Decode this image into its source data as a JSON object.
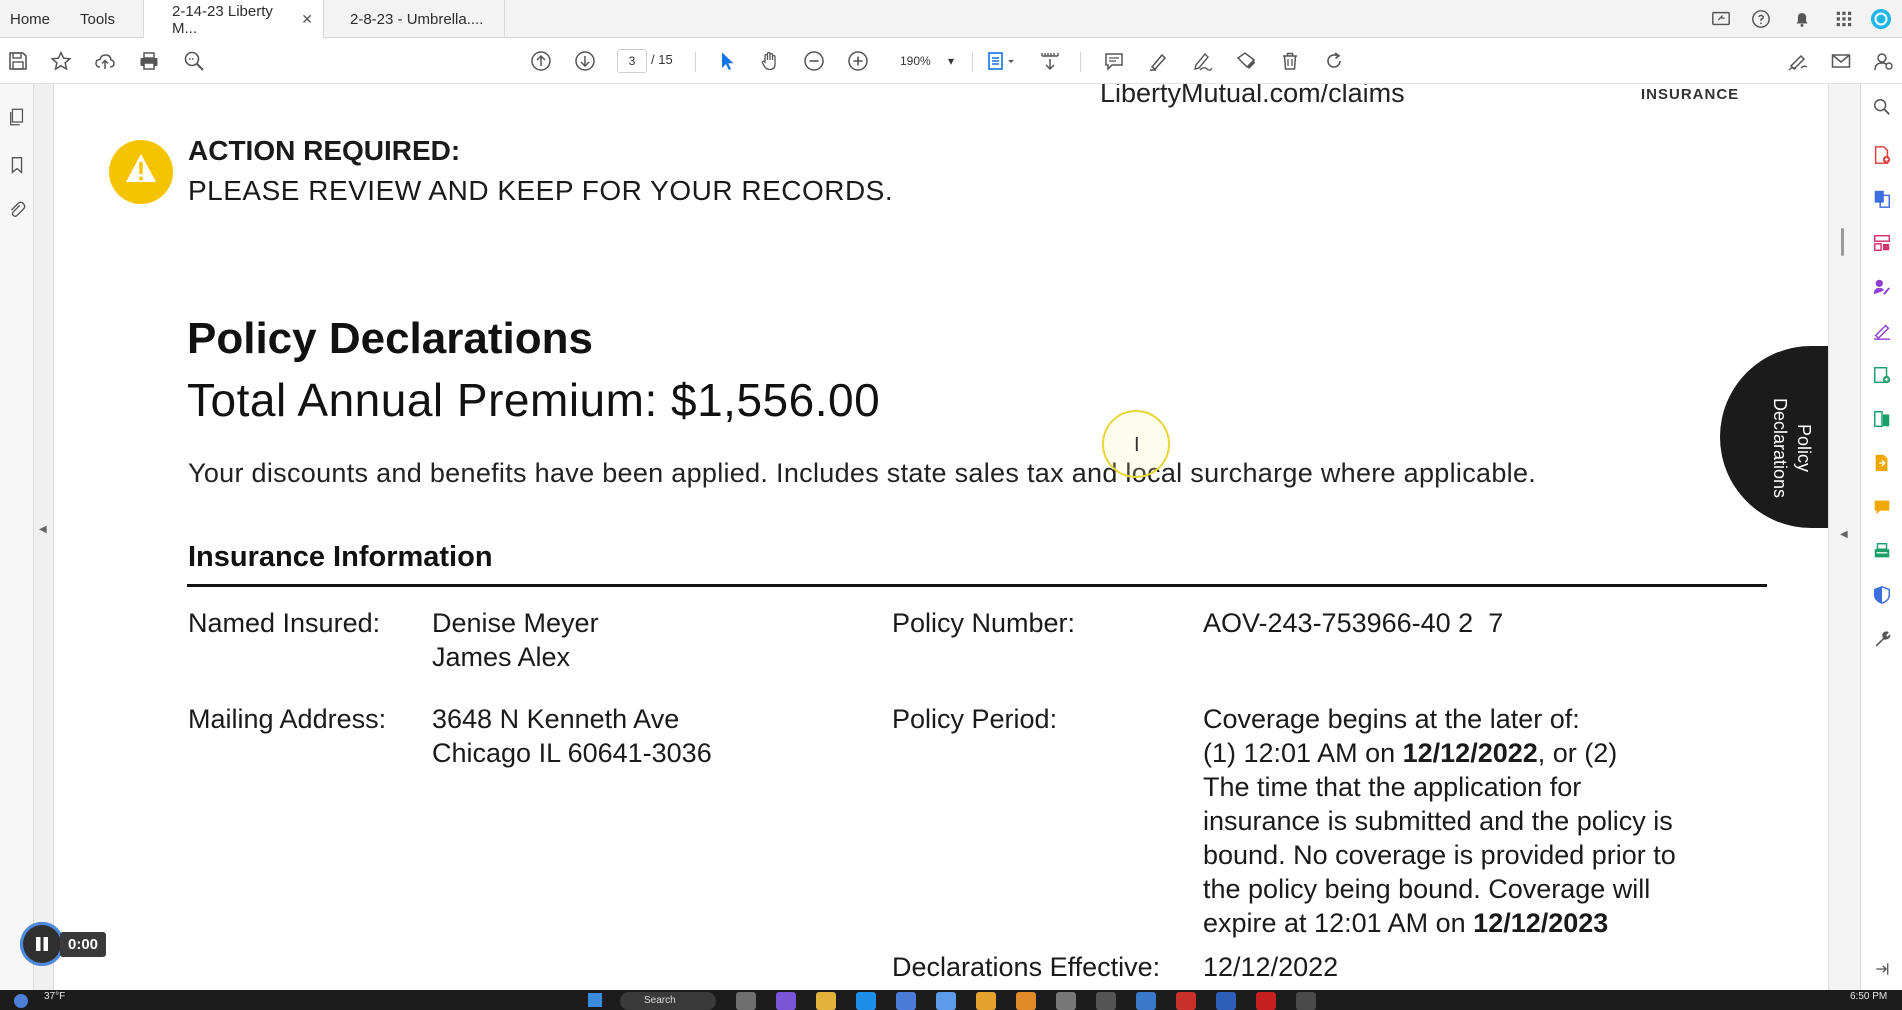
{
  "tabs": [
    {
      "label": "Home"
    },
    {
      "label": "Tools"
    },
    {
      "label": "2-14-23 Liberty M...",
      "close": "✕"
    },
    {
      "label": "2-8-23 - Umbrella...."
    }
  ],
  "toolbar": {
    "current_page": "3",
    "page_total": "/ 15",
    "zoom": "190%",
    "zoom_caret": "▾"
  },
  "header": {
    "claims_url": "LibertyMutual.com/claims",
    "brand_insurance": "INSURANCE"
  },
  "alert": {
    "title": "ACTION REQUIRED:",
    "message": "PLEASE REVIEW AND KEEP FOR YOUR RECORDS."
  },
  "declarations": {
    "title": "Policy Declarations",
    "premium": "Total Annual Premium: $1,556.00",
    "discount_note": "Your discounts and benefits have been applied. Includes state sales tax and local surcharge where applicable.",
    "side_tab_line1": "Policy",
    "side_tab_line2": "Declarations"
  },
  "insurance_info": {
    "heading": "Insurance Information",
    "named_insured_label": "Named Insured:",
    "named_insured_1": "Denise Meyer",
    "named_insured_2": "James Alex",
    "mailing_address_label": "Mailing Address:",
    "address_line_1": "3648 N Kenneth Ave",
    "address_line_2": "Chicago IL 60641-3036",
    "policy_number_label": "Policy Number:",
    "policy_number": "AOV-243-753966-40 2  7",
    "policy_period_label": "Policy Period:",
    "period_line_1": "Coverage begins at the later of:",
    "period_line_2a": "(1) 12:01 AM on ",
    "period_start": "12/12/2022",
    "period_line_2b": ", or (2)",
    "period_line_3": "The time that the application for",
    "period_line_4": "insurance is submitted and the policy is",
    "period_line_5": "bound. No coverage is provided prior to",
    "period_line_6": "the policy being bound. Coverage will",
    "period_line_7a": "expire at 12:01 AM on ",
    "period_end": "12/12/2023",
    "declarations_effective_label": "Declarations Effective:",
    "declarations_effective": "12/12/2022"
  },
  "media": {
    "time": "0:00"
  },
  "taskbar": {
    "weather": "37°F",
    "clock": "6:50 PM",
    "search": "Search"
  },
  "colors": {
    "alert_yellow": "#f5c400",
    "side_tab": "#1b1b1b",
    "accent_blue": "#1473e6"
  }
}
